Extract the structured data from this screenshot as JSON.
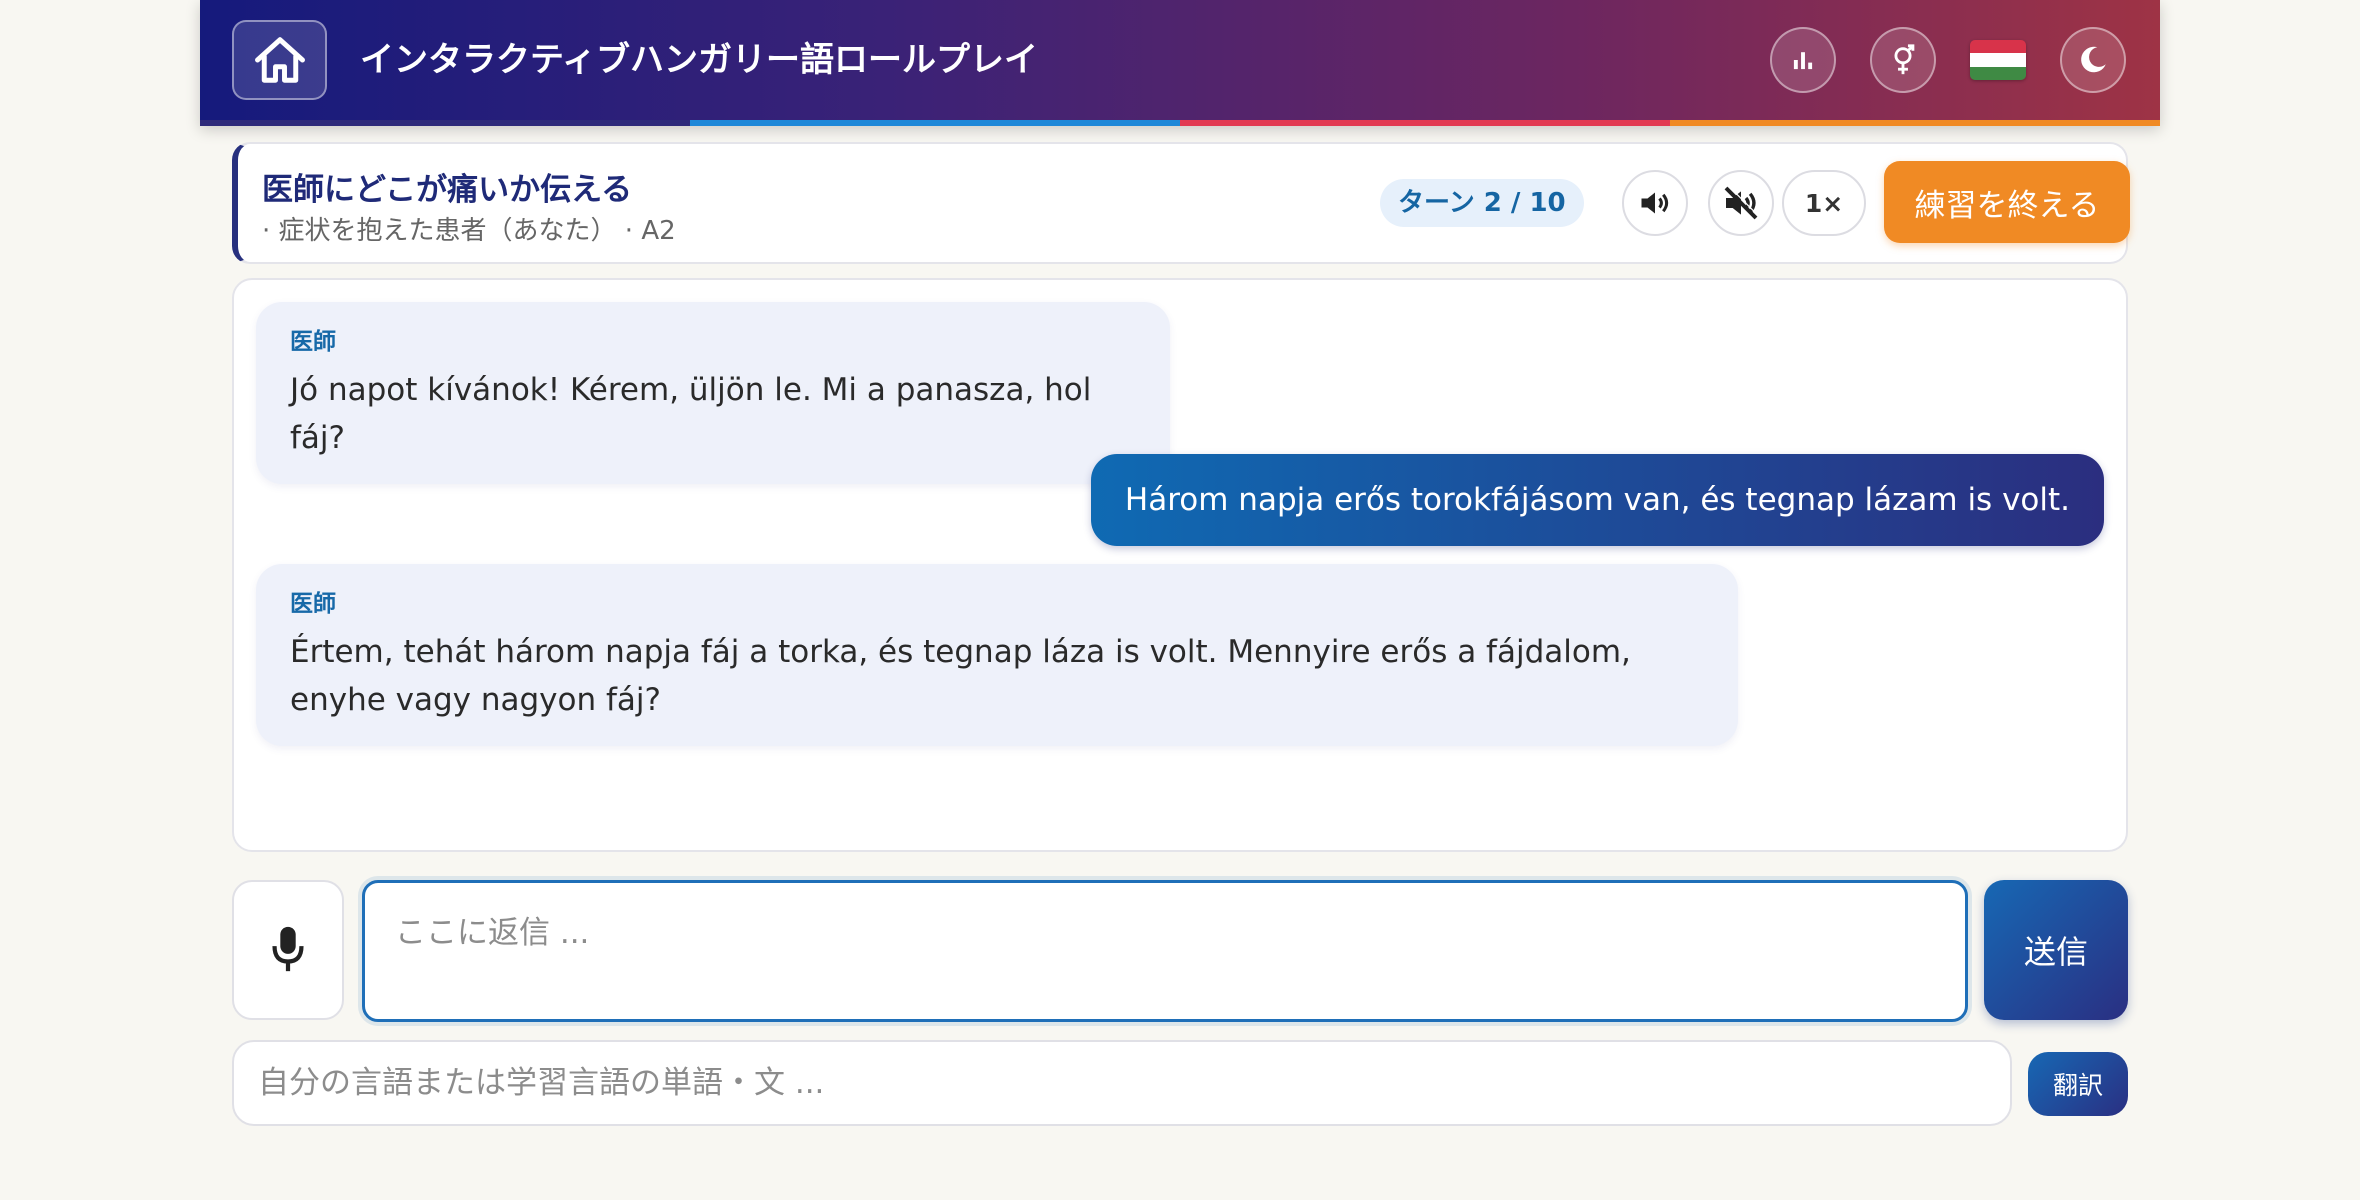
{
  "header": {
    "title": "インタラクティブハンガリー語ロールプレイ",
    "icons": {
      "home": "home-icon",
      "stats": "bar-chart-icon",
      "gender": "gender-icon",
      "language_flag": "hungary-flag-icon",
      "theme": "moon-icon"
    },
    "stripe_colors": [
      "#2e2a7a",
      "#1e88d8",
      "#e23a52",
      "#f08a24"
    ]
  },
  "scenario": {
    "title": "医師にどこが痛いか伝える",
    "subtitle": "· 症状を抱えた患者（あなた） · A2",
    "turn_label": "ターン 2 / 10",
    "speed_label": "1×",
    "end_button": "練習を終える",
    "icons": {
      "sound": "speaker-icon",
      "mute": "mute-icon"
    }
  },
  "messages": [
    {
      "role": "bot",
      "speaker": "医師",
      "text": "Jó napot kívánok! Kérem, üljön le. Mi a panasza, hol fáj?"
    },
    {
      "role": "user",
      "text": "Három napja erős torokfájásom van, és tegnap lázam is volt."
    },
    {
      "role": "bot",
      "speaker": "医師",
      "text": "Értem, tehát három napja fáj a torka, és tegnap láza is volt. Mennyire erős a fájdalom, enyhe vagy nagyon fáj?"
    }
  ],
  "composer": {
    "reply_placeholder": "ここに返信 ...",
    "send_label": "送信",
    "translate_placeholder": "自分の言語または学習言語の単語・文 ...",
    "translate_label": "翻訳",
    "mic_icon": "microphone-icon"
  },
  "colors": {
    "accent": "#1f6fb8",
    "end_button": "#f08a24",
    "speaker": "#1769a8"
  }
}
